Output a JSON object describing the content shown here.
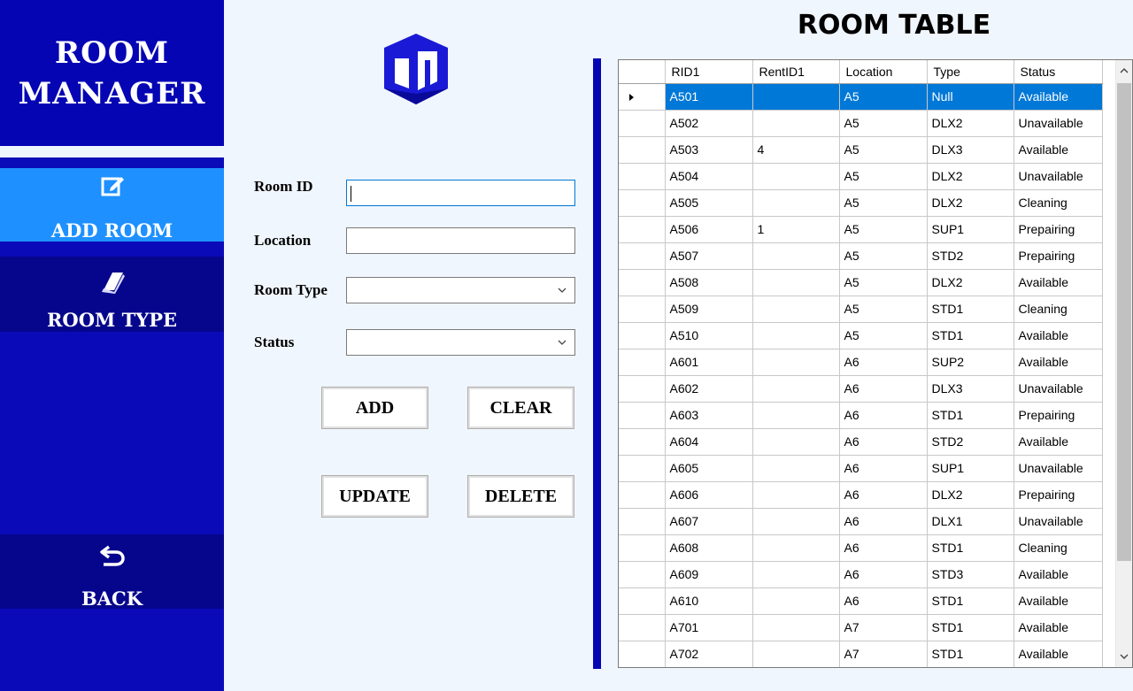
{
  "sidebar": {
    "brand_line1": "ROOM",
    "brand_line2": "MANAGER",
    "nav": {
      "add_room": {
        "label": "ADD ROOM",
        "icon": "edit-icon"
      },
      "room_type": {
        "label": "ROOM TYPE",
        "icon": "book-icon"
      },
      "back": {
        "label": "BACK",
        "icon": "undo-icon"
      }
    }
  },
  "form": {
    "room_id_label": "Room ID",
    "room_id_value": "",
    "location_label": "Location",
    "location_value": "",
    "room_type_label": "Room Type",
    "room_type_value": "",
    "status_label": "Status",
    "status_value": ""
  },
  "buttons": {
    "add": "ADD",
    "clear": "CLEAR",
    "update": "UPDATE",
    "delete": "DELETE"
  },
  "table": {
    "title": "ROOM TABLE",
    "columns": [
      "RID1",
      "RentID1",
      "Location",
      "Type",
      "Status"
    ],
    "selected_row": 0,
    "rows": [
      [
        "A501",
        "",
        "A5",
        "Null",
        "Available"
      ],
      [
        "A502",
        "",
        "A5",
        "DLX2",
        "Unavailable"
      ],
      [
        "A503",
        "4",
        "A5",
        "DLX3",
        "Available"
      ],
      [
        "A504",
        "",
        "A5",
        "DLX2",
        "Unavailable"
      ],
      [
        "A505",
        "",
        "A5",
        "DLX2",
        "Cleaning"
      ],
      [
        "A506",
        "1",
        "A5",
        "SUP1",
        "Prepairing"
      ],
      [
        "A507",
        "",
        "A5",
        "STD2",
        "Prepairing"
      ],
      [
        "A508",
        "",
        "A5",
        "DLX2",
        "Available"
      ],
      [
        "A509",
        "",
        "A5",
        "STD1",
        "Cleaning"
      ],
      [
        "A510",
        "",
        "A5",
        "STD1",
        "Available"
      ],
      [
        "A601",
        "",
        "A6",
        "SUP2",
        "Available"
      ],
      [
        "A602",
        "",
        "A6",
        "DLX3",
        "Unavailable"
      ],
      [
        "A603",
        "",
        "A6",
        "STD1",
        "Prepairing"
      ],
      [
        "A604",
        "",
        "A6",
        "STD2",
        "Available"
      ],
      [
        "A605",
        "",
        "A6",
        "SUP1",
        "Unavailable"
      ],
      [
        "A606",
        "",
        "A6",
        "DLX2",
        "Prepairing"
      ],
      [
        "A607",
        "",
        "A6",
        "DLX1",
        "Unavailable"
      ],
      [
        "A608",
        "",
        "A6",
        "STD1",
        "Cleaning"
      ],
      [
        "A609",
        "",
        "A6",
        "STD3",
        "Available"
      ],
      [
        "A610",
        "",
        "A6",
        "STD1",
        "Available"
      ],
      [
        "A701",
        "",
        "A7",
        "STD1",
        "Available"
      ],
      [
        "A702",
        "",
        "A7",
        "STD1",
        "Available"
      ]
    ]
  },
  "colors": {
    "sidebar": "#0a0ab8",
    "nav_active": "#1e90ff",
    "nav_dark": "#06068c",
    "selection": "#0078d7"
  }
}
